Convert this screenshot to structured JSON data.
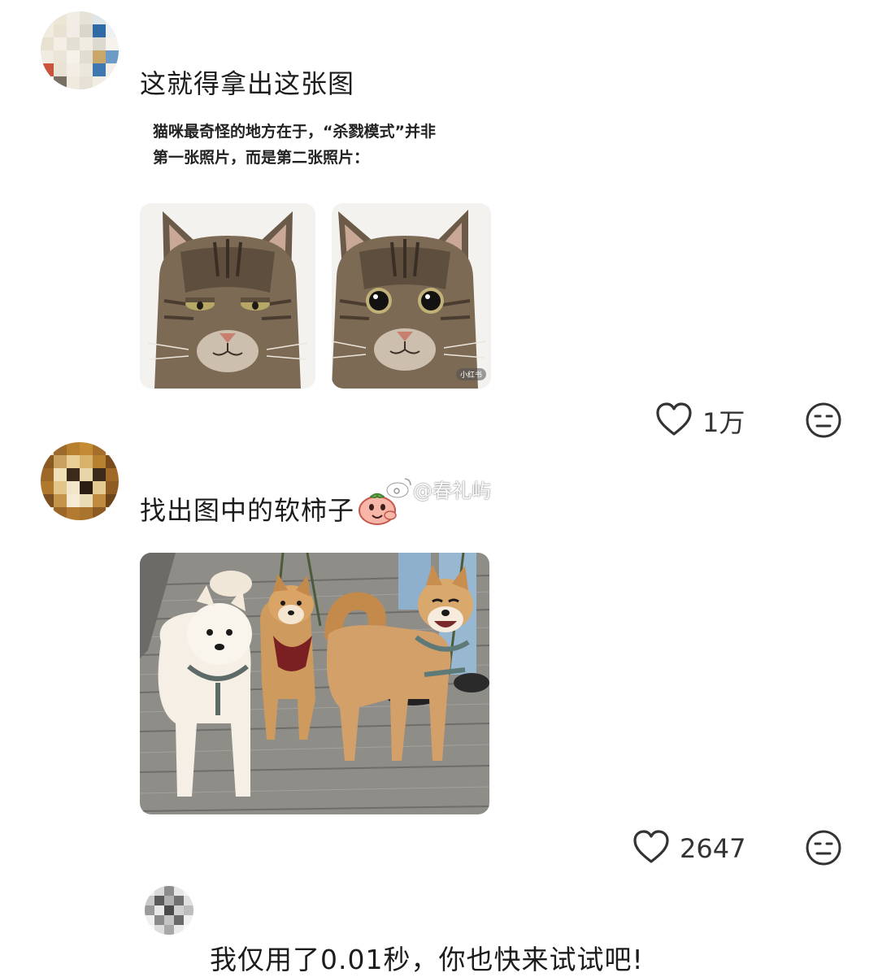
{
  "comments": [
    {
      "text": "这就得拿出这张图",
      "image": {
        "caption_line1": "猫咪最奇怪的地方在于，“杀戮模式”并非",
        "caption_line2": "第一张照片，而是第二张照片：",
        "badge": "小红书"
      },
      "likes": "1万",
      "like_icon": "heart-outline-icon",
      "reaction_icon": "neutral-face-icon"
    },
    {
      "text": "找出图中的软柿子",
      "emoji_icon": "persimmon-emoji-icon",
      "likes": "2647",
      "like_icon": "heart-outline-icon",
      "reaction_icon": "neutral-face-icon"
    }
  ],
  "reply": {
    "text": "我仅用了0.01秒，你也快来试试吧!"
  },
  "watermark": {
    "text": "@春礼屿"
  },
  "colors": {
    "icon": "#333333",
    "text": "#1c1c1c"
  }
}
